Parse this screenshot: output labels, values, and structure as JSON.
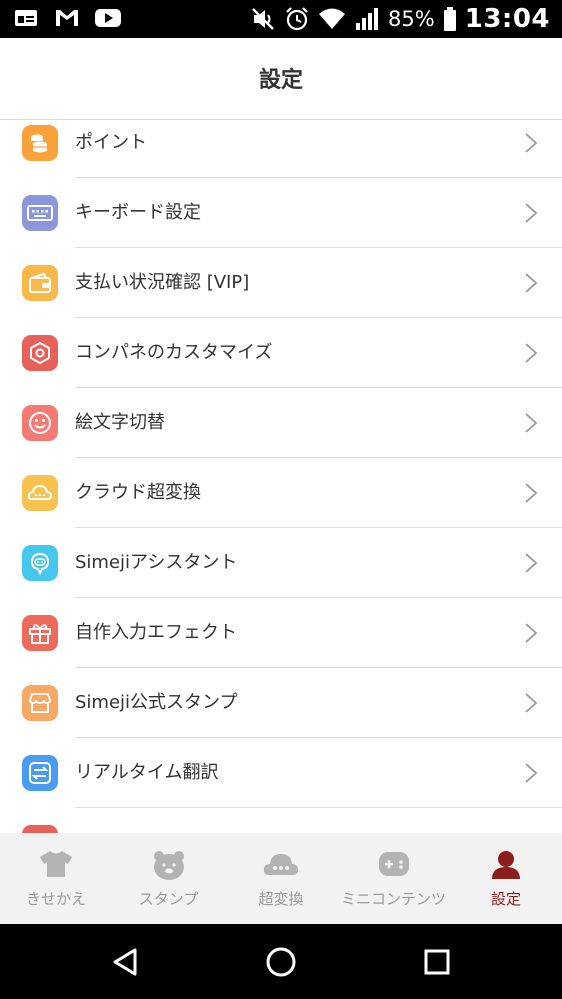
{
  "status_bar": {
    "left_icons": [
      "sim-card-icon",
      "gmail-icon",
      "youtube-icon"
    ],
    "right_icons": [
      "mute-icon",
      "alarm-icon",
      "wifi-icon",
      "signal-icon",
      "battery-icon"
    ],
    "battery": "85%",
    "time": "13:04"
  },
  "header": {
    "title": "設定"
  },
  "menu": {
    "items": [
      {
        "label": "ポイント",
        "icon": "coin-stack-icon",
        "color": "#f9a23a"
      },
      {
        "label": "キーボード設定",
        "icon": "keyboard-icon",
        "color": "#8b97dc"
      },
      {
        "label": "支払い状況確認 [VIP]",
        "icon": "wallet-icon",
        "color": "#f8b94a"
      },
      {
        "label": "コンパネのカスタマイズ",
        "icon": "hexagon-icon",
        "color": "#e8605a"
      },
      {
        "label": "絵文字切替",
        "icon": "smiley-icon",
        "color": "#f47b75"
      },
      {
        "label": "クラウド超変換",
        "icon": "cloud-icon",
        "color": "#f8c24e"
      },
      {
        "label": "Simejiアシスタント",
        "icon": "robot-icon",
        "color": "#46c7ee"
      },
      {
        "label": "自作入力エフェクト",
        "icon": "gift-icon",
        "color": "#ee6a5a"
      },
      {
        "label": "Simeji公式スタンプ",
        "icon": "shop-icon",
        "color": "#f8a865"
      },
      {
        "label": "リアルタイム翻訳",
        "icon": "translate-icon",
        "color": "#4a9cf0"
      }
    ]
  },
  "tabbar": {
    "tabs": [
      {
        "label": "きせかえ",
        "icon": "tshirt-icon",
        "active": false
      },
      {
        "label": "スタンプ",
        "icon": "bear-icon",
        "active": false
      },
      {
        "label": "超変換",
        "icon": "cloud-icon",
        "active": false
      },
      {
        "label": "ミニコンテンツ",
        "icon": "gamepad-icon",
        "active": false
      },
      {
        "label": "設定",
        "icon": "person-icon",
        "active": true
      }
    ],
    "inactive_color": "#9a9a9a",
    "active_color": "#8b1d1d"
  },
  "navbar": {
    "buttons": [
      "back-icon",
      "home-icon",
      "recents-icon"
    ]
  }
}
